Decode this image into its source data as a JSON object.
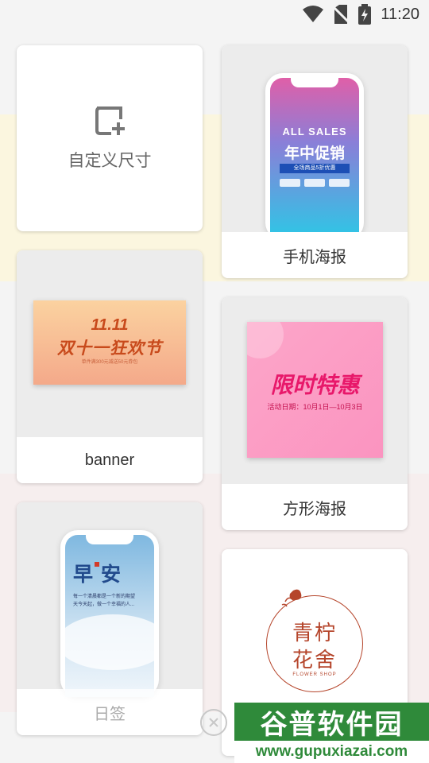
{
  "status_bar": {
    "time": "11:20"
  },
  "templates": {
    "custom": {
      "label": "自定义尺寸"
    },
    "phone_poster": {
      "label": "手机海报",
      "preview_heading": "ALL SALES",
      "preview_title": "年中促销",
      "preview_ribbon": "全场商品5折优惠"
    },
    "banner": {
      "label": "banner",
      "preview_date": "11.11",
      "preview_title": "双十一狂欢节",
      "preview_sub": "单件满300元减送50元券包"
    },
    "square_poster": {
      "label": "方形海报",
      "preview_title": "限时特惠",
      "preview_sub": "活动日期：10月1日—10月3日"
    },
    "daily": {
      "label": "日签",
      "preview_title_1": "早",
      "preview_title_2": "安",
      "preview_line1": "每一个清晨都是一个新的期望",
      "preview_line2": "天今天起，做一个幸福的人..."
    },
    "logo": {
      "line1": "青柠",
      "line2": "花舍",
      "shop": "FLOWER SHOP"
    }
  },
  "watermark": {
    "line1": "谷普软件园",
    "line2": "www.gupuxiazai.com"
  },
  "colors": {
    "accent_red": "#b5452b",
    "gray_text": "#666666"
  }
}
